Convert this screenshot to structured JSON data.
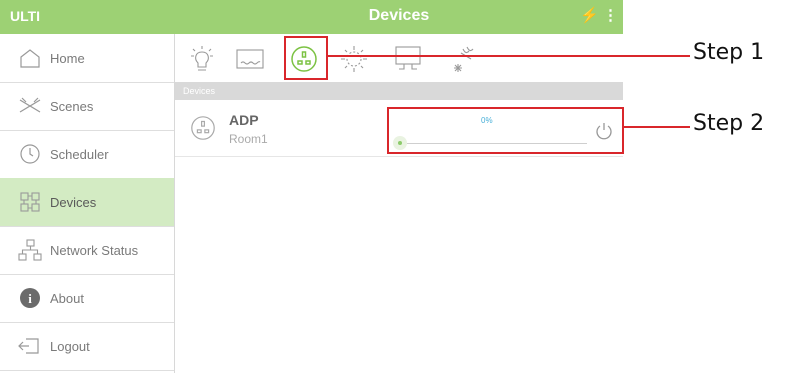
{
  "app": {
    "brand": "ULTI",
    "title": "Devices",
    "bolt_icon": "bolt-icon",
    "menu_icon": "kebab-menu-icon"
  },
  "colors": {
    "header": "#9dd174",
    "active_item": "#d3ebc3",
    "callout": "#d9262b",
    "accent_blue": "#4ab0d8"
  },
  "sidebar": {
    "items": [
      {
        "label": "Home",
        "icon": "home-icon",
        "active": false
      },
      {
        "label": "Scenes",
        "icon": "scenes-icon",
        "active": false
      },
      {
        "label": "Scheduler",
        "icon": "clock-icon",
        "active": false
      },
      {
        "label": "Devices",
        "icon": "devices-icon",
        "active": true
      },
      {
        "label": "Network Status",
        "icon": "network-icon",
        "active": false
      },
      {
        "label": "About",
        "icon": "info-icon",
        "active": false
      },
      {
        "label": "Logout",
        "icon": "logout-icon",
        "active": false
      }
    ]
  },
  "device_types": [
    "light-bulb-icon",
    "heater-icon",
    "socket-icon",
    "dimmer-icon",
    "monitor-icon",
    "ac-icon"
  ],
  "section": {
    "label": "Devices"
  },
  "device": {
    "name": "ADP",
    "room": "Room1",
    "level_text": "0%",
    "level": 0
  },
  "callouts": {
    "step1": "Step 1",
    "step2": "Step 2"
  }
}
